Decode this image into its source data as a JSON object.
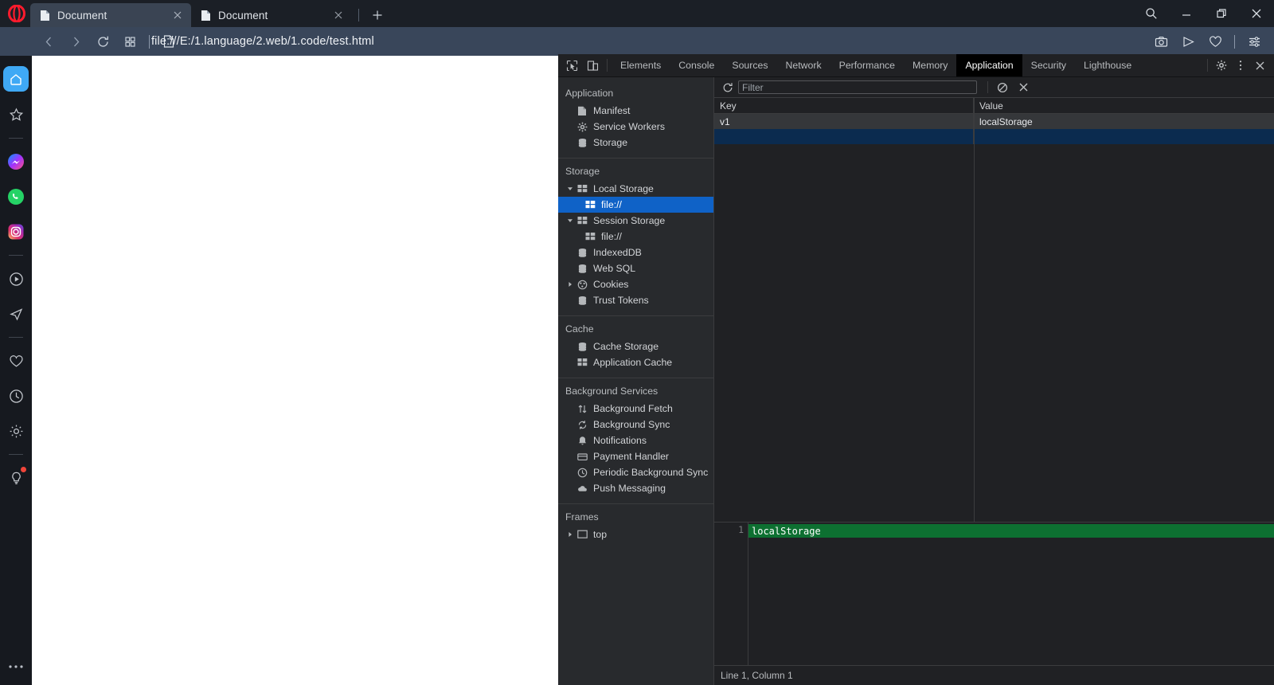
{
  "browser": {
    "logo": "opera-logo",
    "tabs": [
      {
        "title": "Document",
        "icon": "page-icon",
        "active": true
      },
      {
        "title": "Document",
        "icon": "page-icon",
        "active": false
      }
    ],
    "new_tab_label": "+",
    "window_controls": [
      "search-icon",
      "minimize-icon",
      "restore-icon",
      "close-icon"
    ],
    "nav": {
      "back": "back-icon",
      "forward": "forward-icon",
      "reload": "reload-icon",
      "tab_grid": "tab-grid-icon",
      "page_icon": "page-icon",
      "url": "file:///E:/1.language/2.web/1.code/test.html"
    },
    "nav_right": [
      "camera-icon",
      "send-icon",
      "heart-icon",
      "sliders-icon"
    ]
  },
  "left_sidebar": {
    "items": [
      {
        "name": "home-icon",
        "selected": true
      },
      {
        "name": "star-icon",
        "selected": false
      },
      {
        "name": "divider",
        "selected": false
      },
      {
        "name": "messenger-icon",
        "selected": false
      },
      {
        "name": "whatsapp-icon",
        "selected": false
      },
      {
        "name": "instagram-icon",
        "selected": false
      },
      {
        "name": "divider",
        "selected": false
      },
      {
        "name": "player-icon",
        "selected": false
      },
      {
        "name": "telegram-icon",
        "selected": false
      },
      {
        "name": "divider",
        "selected": false
      },
      {
        "name": "heart-icon",
        "selected": false
      },
      {
        "name": "history-icon",
        "selected": false
      },
      {
        "name": "settings-icon",
        "selected": false
      },
      {
        "name": "divider",
        "selected": false
      },
      {
        "name": "tips-icon",
        "selected": false,
        "badge": true
      }
    ],
    "more_label": "more-icon"
  },
  "devtools": {
    "left_icons": [
      "inspect-element-icon",
      "device-toolbar-icon"
    ],
    "tabs": [
      {
        "label": "Elements",
        "active": false
      },
      {
        "label": "Console",
        "active": false
      },
      {
        "label": "Sources",
        "active": false
      },
      {
        "label": "Network",
        "active": false
      },
      {
        "label": "Performance",
        "active": false
      },
      {
        "label": "Memory",
        "active": false
      },
      {
        "label": "Application",
        "active": true
      },
      {
        "label": "Security",
        "active": false
      },
      {
        "label": "Lighthouse",
        "active": false
      }
    ],
    "right_icons": [
      "gear-icon",
      "more-vertical-icon",
      "close-icon"
    ],
    "tree": [
      {
        "type": "group",
        "label": "Application"
      },
      {
        "type": "item",
        "label": "Manifest",
        "icon": "manifest-icon",
        "indent": 1
      },
      {
        "type": "item",
        "label": "Service Workers",
        "icon": "gear-icon",
        "indent": 1
      },
      {
        "type": "item",
        "label": "Storage",
        "icon": "database-icon",
        "indent": 1
      },
      {
        "type": "divider"
      },
      {
        "type": "group",
        "label": "Storage"
      },
      {
        "type": "item",
        "label": "Local Storage",
        "icon": "table-icon",
        "indent": 1,
        "twisty": "open"
      },
      {
        "type": "item",
        "label": "file://",
        "icon": "table-icon",
        "indent": 2,
        "selected": true
      },
      {
        "type": "item",
        "label": "Session Storage",
        "icon": "table-icon",
        "indent": 1,
        "twisty": "open"
      },
      {
        "type": "item",
        "label": "file://",
        "icon": "table-icon",
        "indent": 2
      },
      {
        "type": "item",
        "label": "IndexedDB",
        "icon": "database-icon",
        "indent": 1
      },
      {
        "type": "item",
        "label": "Web SQL",
        "icon": "database-icon",
        "indent": 1
      },
      {
        "type": "item",
        "label": "Cookies",
        "icon": "cookie-icon",
        "indent": 1,
        "twisty": "closed"
      },
      {
        "type": "item",
        "label": "Trust Tokens",
        "icon": "database-icon",
        "indent": 1
      },
      {
        "type": "divider"
      },
      {
        "type": "group",
        "label": "Cache"
      },
      {
        "type": "item",
        "label": "Cache Storage",
        "icon": "database-icon",
        "indent": 1
      },
      {
        "type": "item",
        "label": "Application Cache",
        "icon": "table-icon",
        "indent": 1
      },
      {
        "type": "divider"
      },
      {
        "type": "group",
        "label": "Background Services"
      },
      {
        "type": "item",
        "label": "Background Fetch",
        "icon": "updown-arrow-icon",
        "indent": 1
      },
      {
        "type": "item",
        "label": "Background Sync",
        "icon": "sync-icon",
        "indent": 1
      },
      {
        "type": "item",
        "label": "Notifications",
        "icon": "bell-icon",
        "indent": 1
      },
      {
        "type": "item",
        "label": "Payment Handler",
        "icon": "card-icon",
        "indent": 1
      },
      {
        "type": "item",
        "label": "Periodic Background Sync",
        "icon": "clock-icon",
        "indent": 1
      },
      {
        "type": "item",
        "label": "Push Messaging",
        "icon": "cloud-icon",
        "indent": 1
      },
      {
        "type": "divider"
      },
      {
        "type": "group",
        "label": "Frames"
      },
      {
        "type": "item",
        "label": "top",
        "icon": "frame-icon",
        "indent": 1,
        "twisty": "closed"
      }
    ],
    "toolbar": {
      "refresh_icon": "refresh-icon",
      "filter_placeholder": "Filter",
      "filter_value": "",
      "clear_all_icon": "clear-all-icon",
      "delete_icon": "delete-selected-icon"
    },
    "table": {
      "columns": [
        "Key",
        "Value"
      ],
      "rows": [
        {
          "key": "v1",
          "value": "localStorage",
          "selected": false
        },
        {
          "key": "",
          "value": "",
          "selected": true
        }
      ]
    },
    "preview": {
      "line_number": "1",
      "content": "localStorage"
    },
    "status": "Line 1, Column 1"
  },
  "colors": {
    "opera_red": "#ff1b2d",
    "nav_bg": "#39465a",
    "tab_active": "#3a4453",
    "devtools_bg": "#202124",
    "tree_bg": "#282a2d",
    "selection_blue": "#0f62c7",
    "row_selected": "#0b2b4f",
    "preview_green": "#0d7031",
    "sidebar_accent": "#3fa9f5"
  }
}
